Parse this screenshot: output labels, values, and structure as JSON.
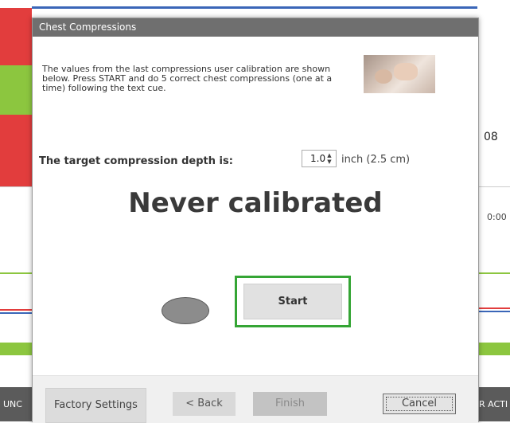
{
  "background": {
    "reading_value": "08",
    "time_label": "0:00",
    "left_bottom_label": "UNC",
    "right_bottom_label": "R ACTI"
  },
  "dialog": {
    "title": "Chest Compressions",
    "intro": "The values from the last compressions user calibration are shown below.  Press START and do 5 correct chest compressions (one at a time) following the text cue.",
    "depth_label": "The target compression depth is:",
    "depth_value": "1.0",
    "depth_unit": "inch (2.5 cm)",
    "status": "Never calibrated",
    "start_label": "Start",
    "factory_label": "Factory Settings",
    "back_label": "< Back",
    "finish_label": "Finish",
    "cancel_label": "Cancel"
  },
  "colors": {
    "accent_green": "#35a535",
    "status_red": "#e23d3d",
    "status_green": "#8cc63f",
    "titlebar": "#6f6f6f"
  }
}
